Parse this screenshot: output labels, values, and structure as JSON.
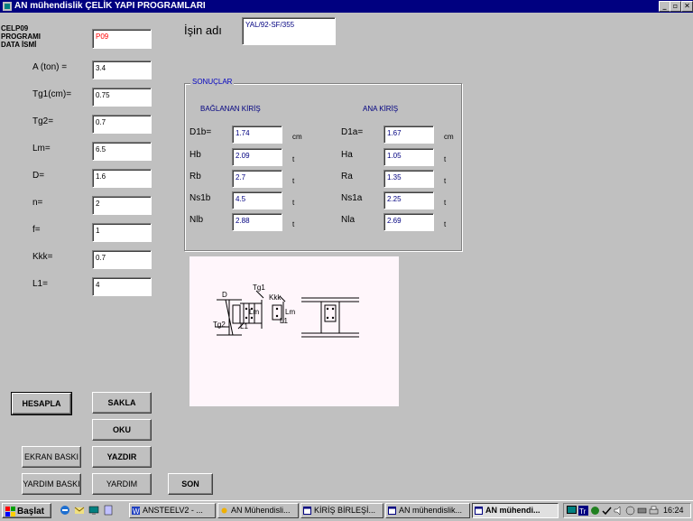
{
  "window": {
    "title": "AN mühendislik  ÇELİK YAPI PROGRAMLARI",
    "min": "_",
    "restore": "▫",
    "close": "✕"
  },
  "header": {
    "program_line1": "CELP09",
    "program_line2": "PROGRAMI",
    "program_line3": "DATA  İSMİ",
    "data_name_value": "P09",
    "job_label": "İşin adı",
    "job_value": "YAL/92-SF/355"
  },
  "inputs": [
    {
      "label": "A (ton) =",
      "value": "3.4"
    },
    {
      "label": "Tg1(cm)=",
      "value": "0.75"
    },
    {
      "label": "Tg2=",
      "value": "0.7"
    },
    {
      "label": "Lm=",
      "value": "6.5"
    },
    {
      "label": "D=",
      "value": "1.6"
    },
    {
      "label": "n=",
      "value": "2"
    },
    {
      "label": "f=",
      "value": "1"
    },
    {
      "label": "Kkk=",
      "value": "0.7"
    },
    {
      "label": "L1=",
      "value": "4"
    }
  ],
  "results": {
    "group_title": "SONUÇLAR",
    "left_heading": "BAĞLANAN KİRİŞ",
    "right_heading": "ANA KİRİŞ",
    "left": [
      {
        "label": "D1b=",
        "value": "1.74",
        "unit": "cm"
      },
      {
        "label": "Hb",
        "value": "2.09",
        "unit": "t"
      },
      {
        "label": "Rb",
        "value": "2.7",
        "unit": "t"
      },
      {
        "label": "Ns1b",
        "value": "4.5",
        "unit": "t"
      },
      {
        "label": "Nlb",
        "value": "2.88",
        "unit": "t"
      }
    ],
    "right": [
      {
        "label": "D1a=",
        "value": "1.67",
        "unit": "cm"
      },
      {
        "label": "Ha",
        "value": "1.05",
        "unit": "t"
      },
      {
        "label": "Ra",
        "value": "1.35",
        "unit": "t"
      },
      {
        "label": "Ns1a",
        "value": "2.25",
        "unit": "t"
      },
      {
        "label": "Nla",
        "value": "2.69",
        "unit": "t"
      }
    ]
  },
  "diagram": {
    "labels": {
      "d": "D",
      "tg1": "Tg1",
      "kkk": "Kkk",
      "lm1": "Lm",
      "lm2": "Lm",
      "tg2": "Tg2",
      "l1a": "L1",
      "l1b": "L1"
    }
  },
  "buttons": {
    "hesapla": "HESAPLA",
    "sakla": "SAKLA",
    "oku": "OKU",
    "ekran_baski": "EKRAN BASKI",
    "yazdir": "YAZDIR",
    "yardim_baski": "YARDIM BASKI",
    "yardim": "YARDIM",
    "son": "SON"
  },
  "taskbar": {
    "start": "Başlat",
    "tasks": [
      "ANSTEELV2 - ...",
      "AN Mühendisli...",
      "KİRİŞ BİRLEŞİ...",
      "AN mühendislik...",
      "AN mühendi..."
    ],
    "clock": "16:24"
  },
  "colors": {
    "titlebar": "#000080",
    "face": "#c0c0c0",
    "field_text": "#000080",
    "data_name_text": "#ff0000",
    "group_title": "#0000c0",
    "diagram_bg": "#fff6fb"
  }
}
